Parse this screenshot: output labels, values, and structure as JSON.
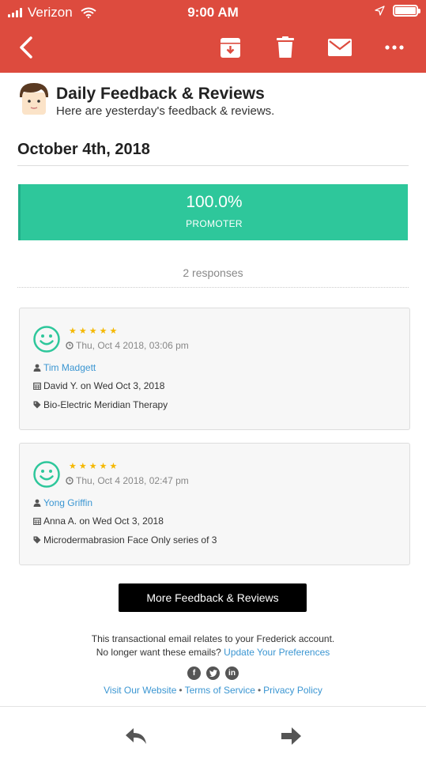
{
  "status_bar": {
    "carrier": "Verizon",
    "time": "9:00 AM"
  },
  "toolbar": {
    "back_icon": "chevron-left-icon",
    "actions": [
      "archive-icon",
      "trash-icon",
      "mail-icon",
      "more-icon"
    ]
  },
  "header": {
    "title": "Daily Feedback & Reviews",
    "subtitle": "Here are yesterday's feedback & reviews."
  },
  "report": {
    "date": "October 4th, 2018",
    "score": "100.0%",
    "score_label": "PROMOTER",
    "responses": "2 responses"
  },
  "reviews": [
    {
      "stars": "★★★★★",
      "rating": 5,
      "timestamp": "Thu, Oct 4 2018, 03:06 pm",
      "customer": "Tim Madgett",
      "appointment": "David Y. on Wed Oct 3, 2018",
      "service": "Bio-Electric Meridian Therapy"
    },
    {
      "stars": "★★★★★",
      "rating": 5,
      "timestamp": "Thu, Oct 4 2018, 02:47 pm",
      "customer": "Yong Griffin",
      "appointment": "Anna A. on Wed Oct 3, 2018",
      "service": "Microdermabrasion Face Only series of 3"
    }
  ],
  "more_button": "More Feedback & Reviews",
  "footer": {
    "line1": "This transactional email relates to your Frederick account.",
    "line2_text": "No longer want these emails?",
    "line2_link": "Update Your Preferences",
    "social": [
      "facebook-icon",
      "twitter-icon",
      "linkedin-icon"
    ],
    "links": [
      "Visit Our Website",
      "Terms of Service",
      "Privacy Policy"
    ],
    "separator": "•"
  },
  "colors": {
    "topbar": "#dd4b3e",
    "promoter": "#2ec79b",
    "link": "#3b96d2",
    "star": "#f5b800"
  }
}
